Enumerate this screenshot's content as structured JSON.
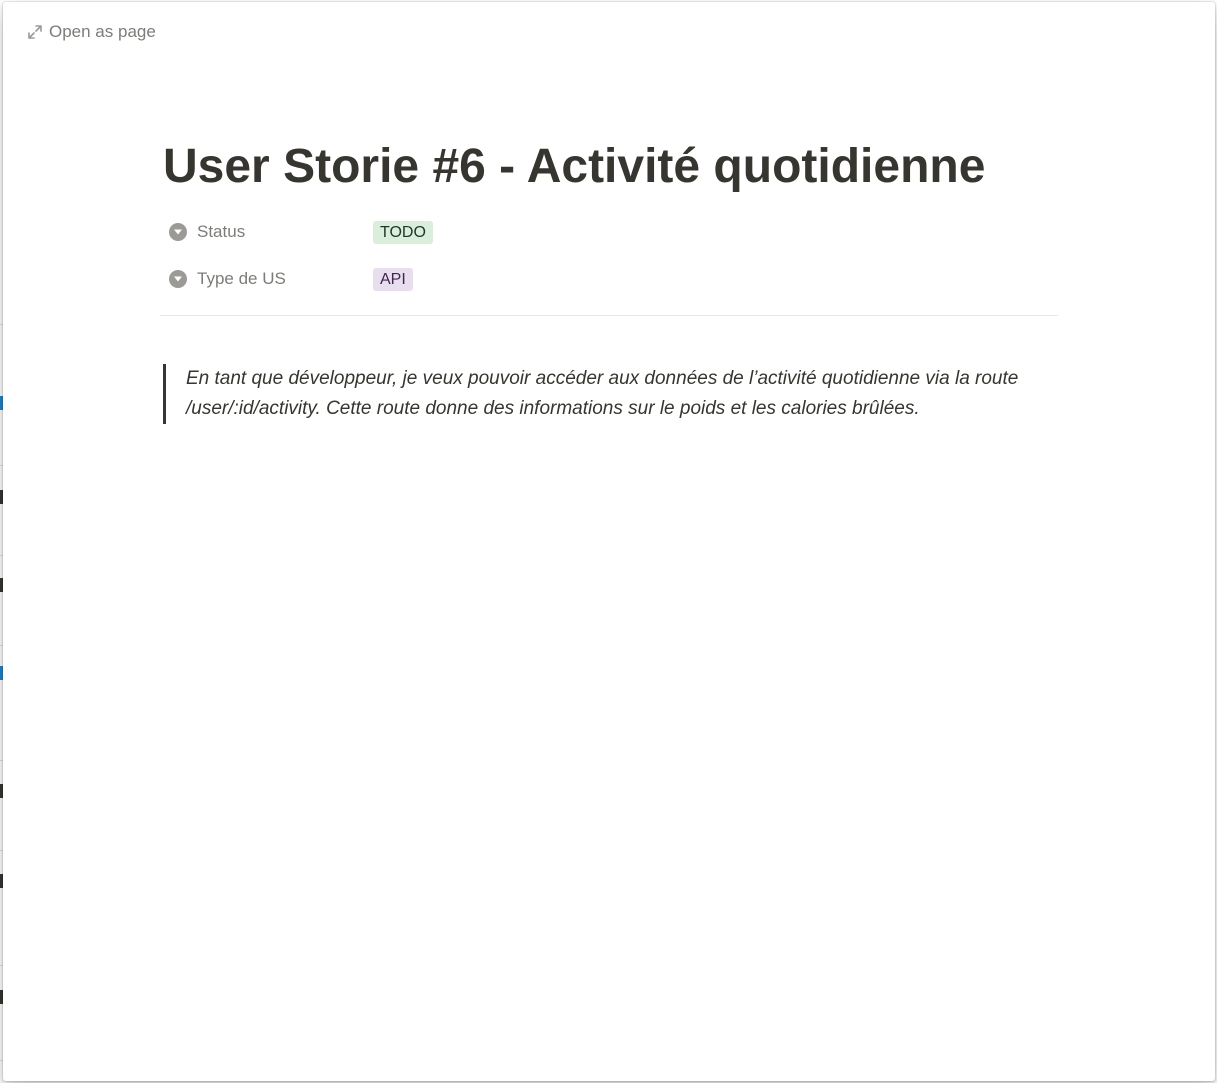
{
  "modal": {
    "open_as_page_label": "Open as page",
    "open_icon": "expand-arrows-icon"
  },
  "page": {
    "title": "User Storie #6 - Activité quotidienne",
    "properties": [
      {
        "name": "Status",
        "icon": "select-circle-icon",
        "value": "TODO",
        "tag_color": "#dbeddb",
        "tag_text_color": "#1c3829"
      },
      {
        "name": "Type de US",
        "icon": "select-circle-icon",
        "value": "API",
        "tag_color": "#e8deee",
        "tag_text_color": "#412454"
      }
    ],
    "quote": "En tant que développeur, je veux pouvoir accéder aux données de l’activité quotidienne via la route /user/:id/activity. Cette route donne des informations sur le poids et les calories brûlées."
  },
  "colors": {
    "text": "#37352f",
    "muted": "#7d7c78",
    "icon": "#9b9a97"
  }
}
